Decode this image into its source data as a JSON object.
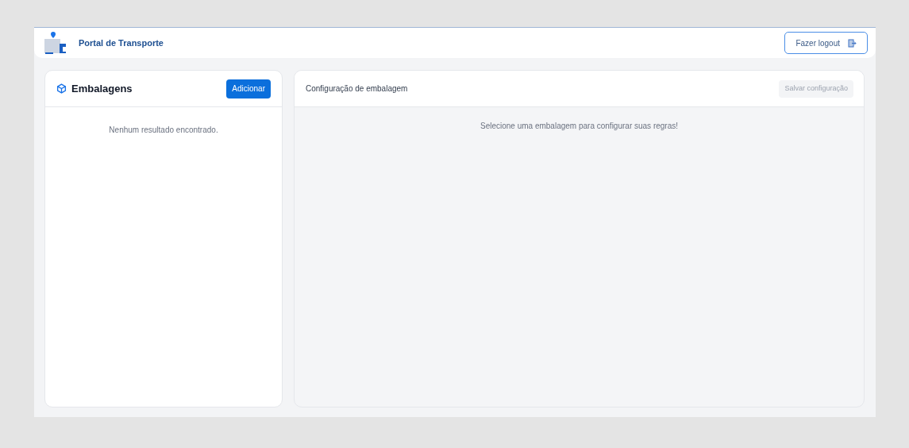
{
  "header": {
    "title": "Portal de Transporte",
    "logout_button": "Fazer logout"
  },
  "packaging_panel": {
    "title": "Embalagens",
    "add_button": "Adicionar",
    "empty_message": "Nenhum resultado encontrado."
  },
  "config_panel": {
    "title": "Configuração de embalagem",
    "save_button": {
      "label": "Salvar configuração",
      "disabled": true
    },
    "empty_message": "Selecione uma embalagem para configurar suas regras!"
  }
}
